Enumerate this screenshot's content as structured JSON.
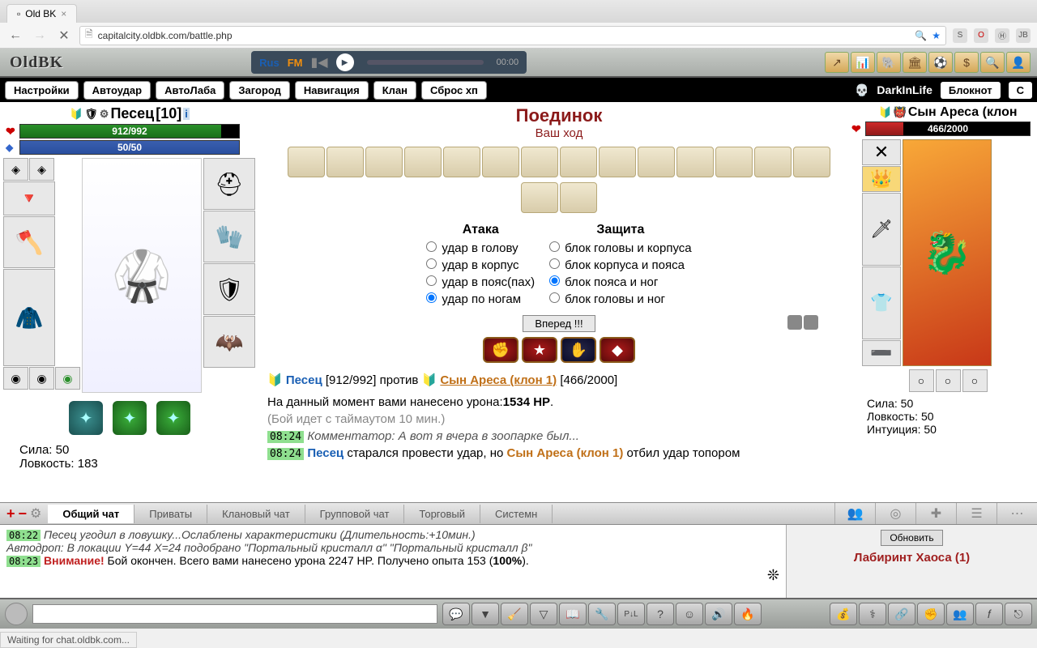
{
  "browser": {
    "tab_title": "Old BK",
    "url": "capitalcity.oldbk.com/battle.php",
    "status": "Waiting for chat.oldbk.com..."
  },
  "radio": {
    "label1": "Rus",
    "label2": "FM",
    "time": "00:00"
  },
  "top_icons": [
    "📈",
    "📊",
    "🐘",
    "🏛",
    "⚽",
    "💰",
    "🔍",
    "👤"
  ],
  "menu": [
    "Настройки",
    "Автоудар",
    "АвтоЛаба",
    "Загород",
    "Навигация",
    "Клан",
    "Сброс хп"
  ],
  "username": "DarkInLife",
  "notepad": "Блокнот",
  "extra_menu": "С",
  "player_left": {
    "name": "Песец",
    "level": "[10]",
    "hp": "912/992",
    "hp_pct": 92,
    "mp": "50/50",
    "mp_pct": 100,
    "stats": {
      "str": "Сила: 50",
      "dex": "Ловкость: 183"
    }
  },
  "player_right": {
    "name": "Сын Ареса (клон",
    "hp": "466/2000",
    "hp_pct": 23,
    "stats": {
      "str": "Сила: 50",
      "dex": "Ловкость: 50",
      "int": "Интуиция: 50"
    }
  },
  "duel": {
    "title": "Поединок",
    "subtitle": "Ваш ход",
    "attack_header": "Атака",
    "defense_header": "Защита",
    "attacks": [
      "удар в голову",
      "удар в корпус",
      "удар в пояс(пах)",
      "удар по ногам"
    ],
    "defenses": [
      "блок головы и корпуса",
      "блок корпуса и пояса",
      "блок пояса и ног",
      "блок головы и ног"
    ],
    "selected_attack": 3,
    "selected_defense": 2,
    "go": "Вперед !!!"
  },
  "vs": {
    "p1": "Песец",
    "p1_hp": "[912/992]",
    "mid": "против",
    "p2": "Сын Ареса (клон 1)",
    "p2_hp": "[466/2000]"
  },
  "log": {
    "dmg_line_1": "На данный момент вами нанесено урона:",
    "dmg_val": "1534 HP",
    "dmg_dot": ".",
    "timeout": "(Бой идет с таймаутом 10 мин.)",
    "comment_t": "08:24",
    "comment": "Комментатор: А вот я вчера в зоопарке был...",
    "l2_t": "08:24",
    "l2_p": "Песец",
    "l2_mid": " старался провести удар, но ",
    "l2_e": "Сын Ареса (клон 1)",
    "l2_end": " отбил удар топором"
  },
  "chat": {
    "tabs": [
      "Общий чат",
      "Приваты",
      "Клановый чат",
      "Групповой чат",
      "Торговый",
      "Системн"
    ],
    "active": 0,
    "line1_t": "08:22",
    "line1": "Песец угодил в ловушку...Ослаблены характеристики (Длительность:+10мин.)",
    "line2": "Автодроп: В локации Y=44 X=24 подобрано \"Портальный кристалл α\" \"Портальный кристалл β\"",
    "line3_t": "08:23",
    "line3_warn": "Внимание!",
    "line3": " Бой окончен. Всего вами нанесено урона 2247 HP. Получено опыта 153 (",
    "line3_bold": "100%",
    "line3_end": ")."
  },
  "side_panel": {
    "refresh": "Обновить",
    "location": "Лабиринт Хаоса (1)"
  },
  "logo": "OldBK"
}
